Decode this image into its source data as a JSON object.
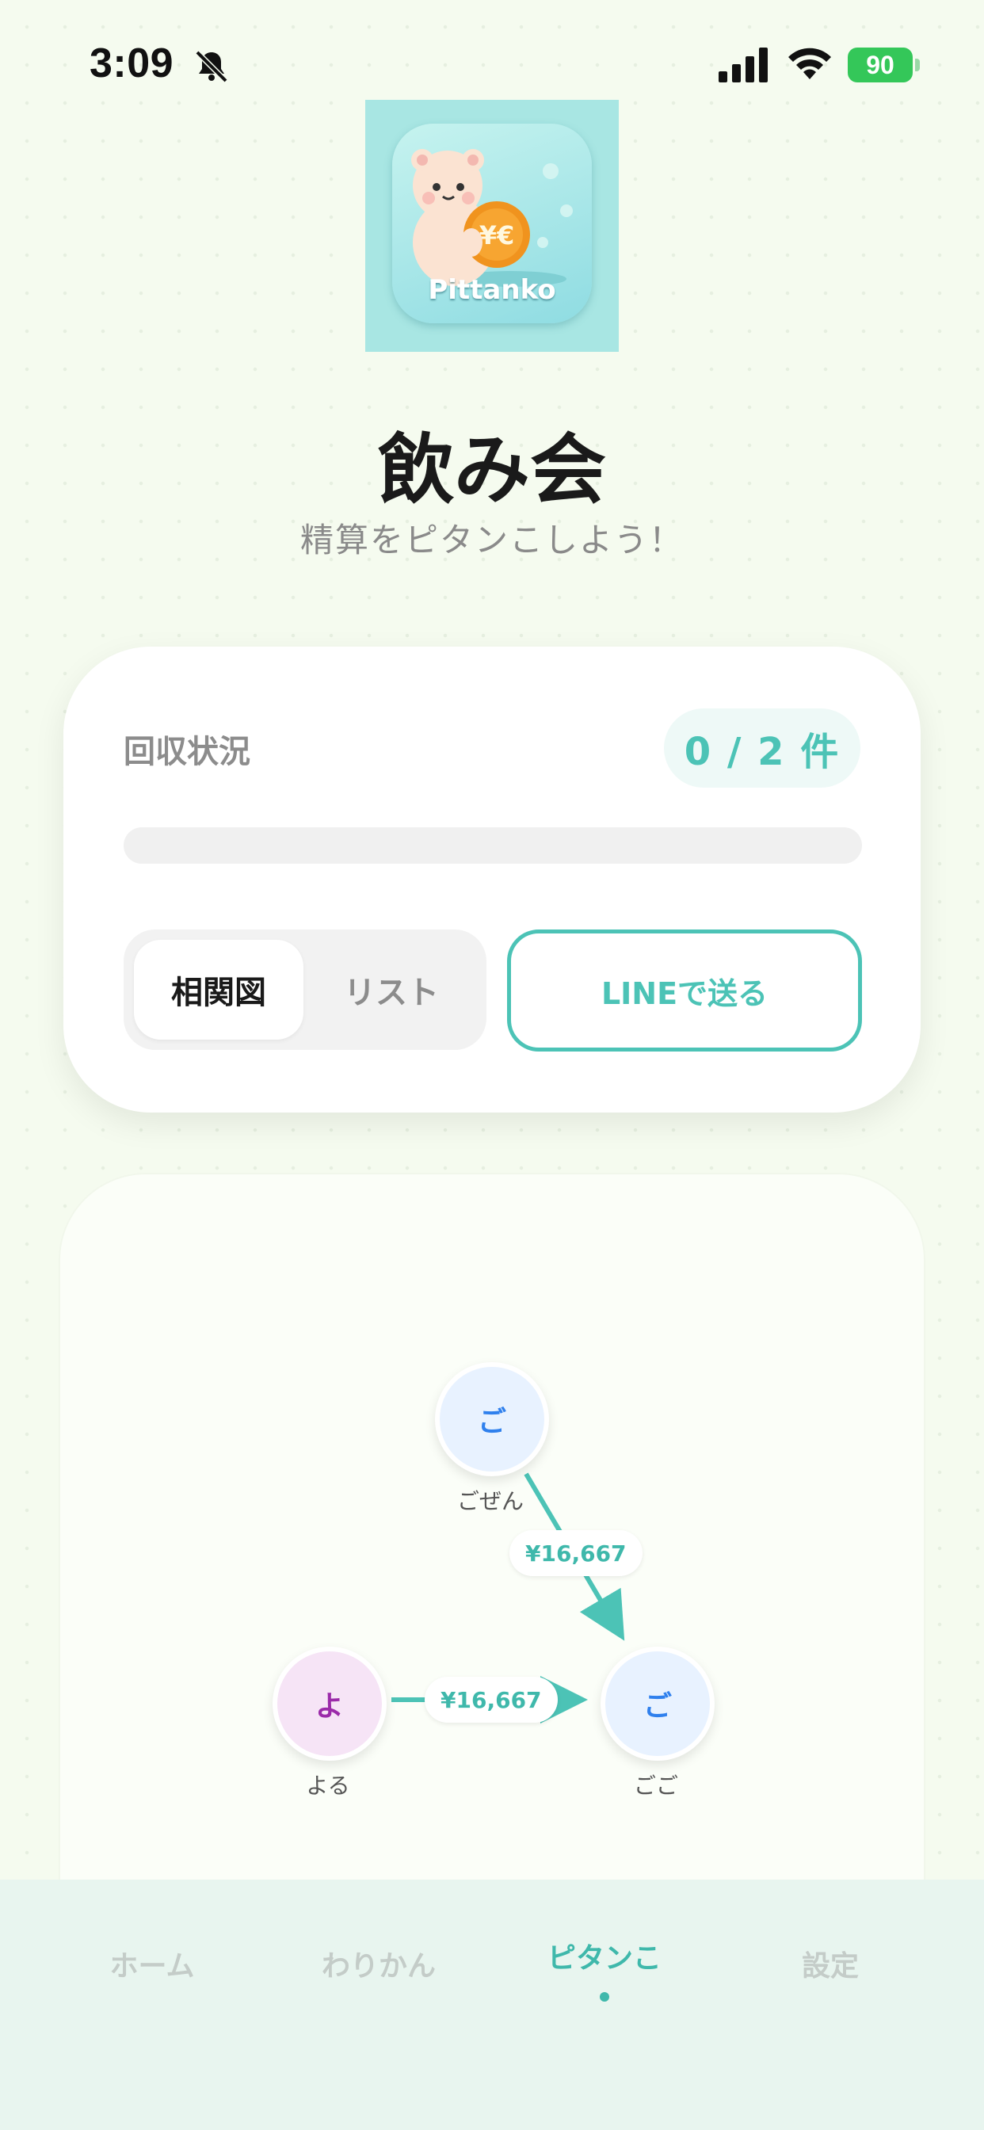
{
  "status_bar": {
    "time": "3:09",
    "battery": "90"
  },
  "app": {
    "icon_name": "bear-holding-coin-icon",
    "icon_label": "Pittanko"
  },
  "header": {
    "title": "飲み会",
    "subtitle": "精算をピタンこしよう！"
  },
  "status_card": {
    "label": "回収状況",
    "count": "0 / 2 件",
    "progress": 0,
    "view_toggle": {
      "options": [
        "相関図",
        "リスト"
      ],
      "selected": "相関図"
    },
    "send_button": "LINEで送る"
  },
  "graph": {
    "nodes": [
      {
        "id": "gozen",
        "initial": "ご",
        "name": "ごぜん",
        "bg": "#e8f2ff",
        "fg": "#2f80ed"
      },
      {
        "id": "yoru",
        "initial": "よ",
        "name": "よる",
        "bg": "#f6e4f6",
        "fg": "#9b2aa9"
      },
      {
        "id": "gogo",
        "initial": "ご",
        "name": "ごご",
        "bg": "#e8f2ff",
        "fg": "#2f80ed"
      }
    ],
    "edges": [
      {
        "from": "ごぜん",
        "to": "ごご",
        "amount": "¥16,667"
      },
      {
        "from": "よる",
        "to": "ごご",
        "amount": "¥16,667"
      }
    ],
    "edge_color": "#4cc3b6"
  },
  "nav": {
    "items": [
      "ホーム",
      "わりかん",
      "ピタンこ",
      "設定"
    ],
    "active": "ピタンこ"
  },
  "colors": {
    "accent": "#4cc3b6",
    "background": "#f5fbef"
  }
}
